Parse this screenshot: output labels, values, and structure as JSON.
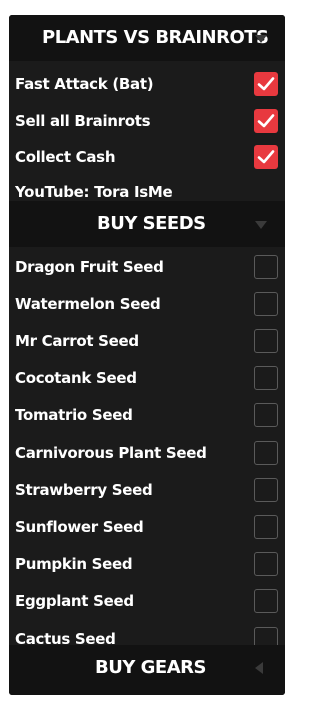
{
  "header": {
    "title": "PLANTS VS BRAINROTS"
  },
  "main_toggles": [
    {
      "label": "Fast Attack (Bat)",
      "checked": true
    },
    {
      "label": "Sell all Brainrots",
      "checked": true
    },
    {
      "label": "Collect Cash",
      "checked": true
    }
  ],
  "credit": "YouTube: Tora IsMe",
  "buy_seeds": {
    "title": "BUY SEEDS",
    "items": [
      {
        "label": "Dragon Fruit Seed",
        "checked": false
      },
      {
        "label": "Watermelon Seed",
        "checked": false
      },
      {
        "label": "Mr Carrot Seed",
        "checked": false
      },
      {
        "label": "Cocotank Seed",
        "checked": false
      },
      {
        "label": "Tomatrio Seed",
        "checked": false
      },
      {
        "label": "Carnivorous Plant Seed",
        "checked": false
      },
      {
        "label": "Strawberry Seed",
        "checked": false
      },
      {
        "label": "Sunflower Seed",
        "checked": false
      },
      {
        "label": "Pumpkin Seed",
        "checked": false
      },
      {
        "label": "Eggplant Seed",
        "checked": false
      },
      {
        "label": "Cactus Seed",
        "checked": false
      }
    ]
  },
  "buy_gears": {
    "title": "BUY GEARS"
  },
  "colors": {
    "panel_bg": "#1b1b1b",
    "header_bg": "#121212",
    "checkbox_on": "#e8393f",
    "checkbox_off_border": "#5a5a5a",
    "text": "#ffffff"
  },
  "icons": {
    "collapse": "chevron-down-icon",
    "expand": "chevron-left-icon",
    "check": "checkmark-icon"
  }
}
